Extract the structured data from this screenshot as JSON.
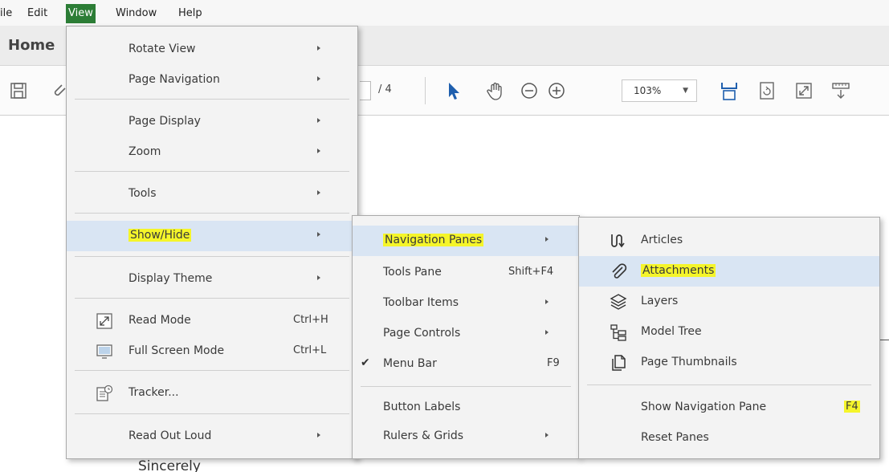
{
  "menubar": {
    "items": [
      "ile",
      "Edit",
      "View",
      "Window",
      "Help"
    ]
  },
  "tabs": {
    "home": "Home"
  },
  "toolbar": {
    "page_total": "/ 4",
    "zoom": "103%"
  },
  "document": {
    "text": "Sincerely"
  },
  "view_menu": {
    "items": [
      {
        "label": "Rotate View"
      },
      {
        "label": "Page Navigation"
      },
      {
        "label": "Page Display"
      },
      {
        "label": "Zoom"
      },
      {
        "label": "Tools"
      },
      {
        "label": "Show/Hide"
      },
      {
        "label": "Display Theme"
      },
      {
        "label": "Read Mode",
        "shortcut": "Ctrl+H"
      },
      {
        "label": "Full Screen Mode",
        "shortcut": "Ctrl+L"
      },
      {
        "label": "Tracker..."
      },
      {
        "label": "Read Out Loud"
      }
    ]
  },
  "showhide_menu": {
    "items": [
      {
        "label": "Navigation Panes"
      },
      {
        "label": "Tools Pane",
        "shortcut": "Shift+F4"
      },
      {
        "label": "Toolbar Items"
      },
      {
        "label": "Page Controls"
      },
      {
        "label": "Menu Bar",
        "shortcut": "F9"
      },
      {
        "label": "Button Labels"
      },
      {
        "label": "Rulers & Grids"
      }
    ]
  },
  "navpanes_menu": {
    "items": [
      {
        "label": "Articles"
      },
      {
        "label": "Attachments"
      },
      {
        "label": "Layers"
      },
      {
        "label": "Model Tree"
      },
      {
        "label": "Page Thumbnails"
      },
      {
        "label": "Show Navigation Pane",
        "shortcut": "F4"
      },
      {
        "label": "Reset Panes"
      }
    ]
  },
  "colors": {
    "view_active": "#2c7d36",
    "hover": "#d9e5f3",
    "highlight": "#f5f52a"
  }
}
